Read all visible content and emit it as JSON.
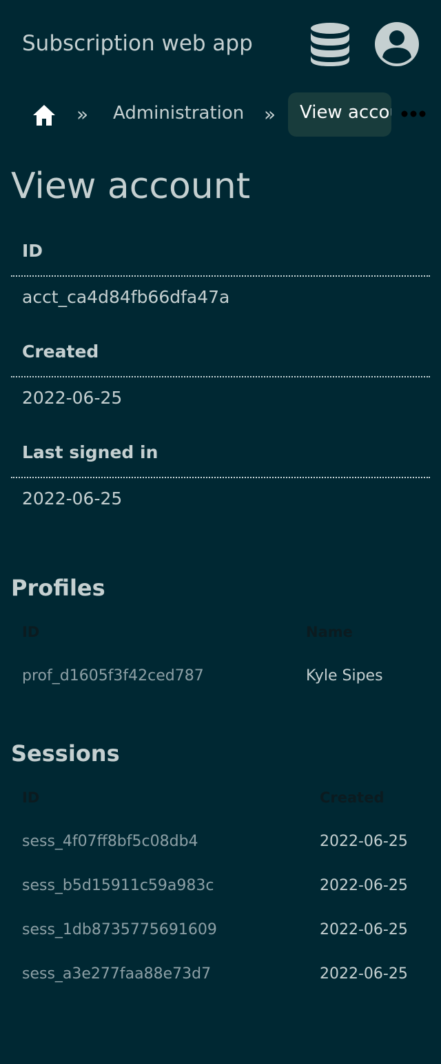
{
  "header": {
    "app_title": "Subscription web app",
    "db_icon": "database-icon",
    "user_icon": "user-circle-icon"
  },
  "breadcrumb": {
    "home_icon": "home-icon",
    "separator": "»",
    "items": [
      "Administration",
      "View account"
    ],
    "more_icon": "ellipsis-icon"
  },
  "page": {
    "title": "View account"
  },
  "details": [
    {
      "label": "ID",
      "value": "acct_ca4d84fb66dfa47a"
    },
    {
      "label": "Created",
      "value": "2022-06-25"
    },
    {
      "label": "Last signed in",
      "value": "2022-06-25"
    }
  ],
  "profiles": {
    "title": "Profiles",
    "columns": [
      "ID",
      "Name"
    ],
    "rows": [
      {
        "id": "prof_d1605f3f42ced787",
        "name": "Kyle Sipes"
      }
    ]
  },
  "sessions": {
    "title": "Sessions",
    "columns": [
      "ID",
      "Created"
    ],
    "rows": [
      {
        "id": "sess_4f07ff8bf5c08db4",
        "created": "2022-06-25"
      },
      {
        "id": "sess_b5d15911c59a983c",
        "created": "2022-06-25"
      },
      {
        "id": "sess_1db8735775691609",
        "created": "2022-06-25"
      },
      {
        "id": "sess_a3e277faa88e73d7",
        "created": "2022-06-25"
      }
    ]
  },
  "colors": {
    "background": "#002833",
    "text": "#c5d0d1",
    "muted_link": "#8da0a6",
    "breadcrumb_pill": "#183c3c",
    "table_header": "#0b1b20"
  }
}
